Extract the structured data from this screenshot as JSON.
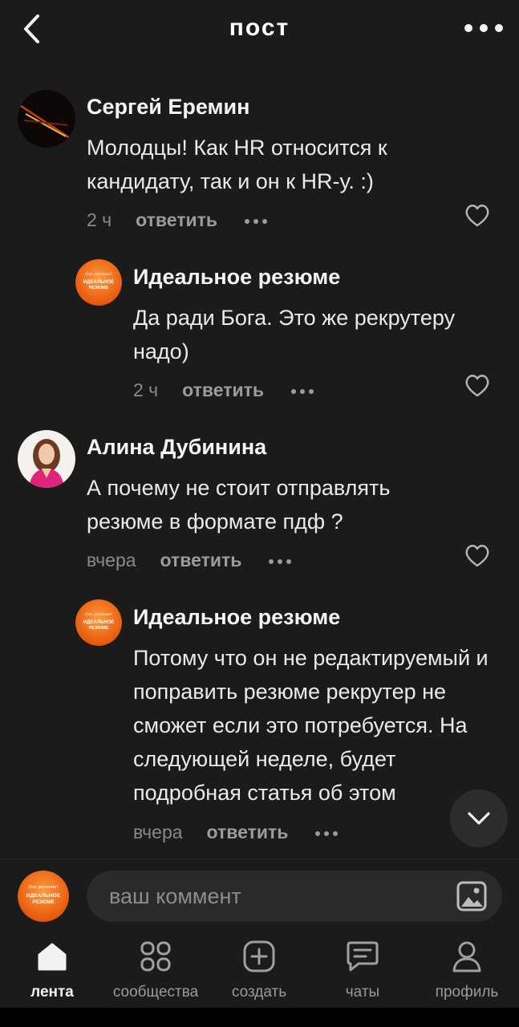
{
  "header": {
    "title": "пост"
  },
  "comments": [
    {
      "author": "Сергей Еремин",
      "text": "Молодцы! Как HR относится к кандидату, так и он к HR-у. :)",
      "time": "2 ч",
      "reply": "ответить"
    },
    {
      "author": "Идеальное резюме",
      "text": "Да ради Бога. Это же рекрутеру надо)",
      "time": "2 ч",
      "reply": "ответить"
    },
    {
      "author": "Алина Дубинина",
      "text": "А почему не стоит отправлять резюме в формате пдф ?",
      "time": "вчера",
      "reply": "ответить"
    },
    {
      "author": "Идеальное резюме",
      "text": "Потому что он не редактируемый и поправить резюме рекрутер не сможет если это потребуется. На следующей неделе, будет подробная статья об этом",
      "time": "вчера",
      "reply": "ответить"
    }
  ],
  "logo": {
    "top": "Ого резюме!",
    "line1": "ИДЕАЛЬНОЕ",
    "line2": "РЕЗЮМЕ"
  },
  "composer": {
    "placeholder": "ваш коммент"
  },
  "tabs": [
    {
      "label": "лента",
      "icon": "home-icon",
      "active": true
    },
    {
      "label": "сообщества",
      "icon": "communities-icon",
      "active": false
    },
    {
      "label": "создать",
      "icon": "create-icon",
      "active": false
    },
    {
      "label": "чаты",
      "icon": "chat-icon",
      "active": false
    },
    {
      "label": "профиль",
      "icon": "profile-icon",
      "active": false
    }
  ],
  "colors": {
    "background": "#1b1b1b",
    "logo_orange": "#f26a0f",
    "text": "#f2f2f2",
    "muted": "#9c9c9c"
  }
}
